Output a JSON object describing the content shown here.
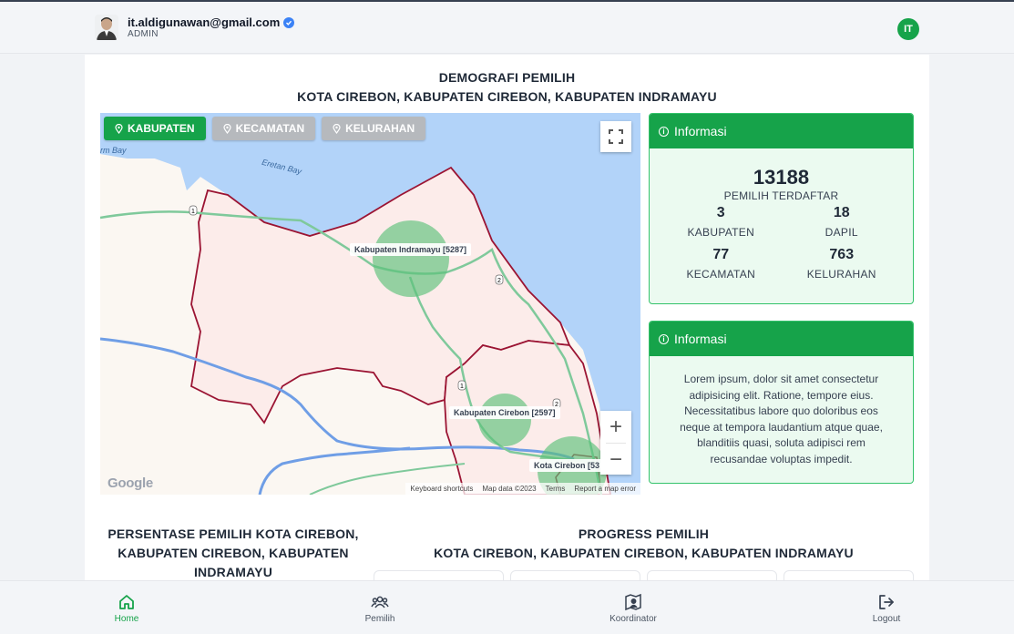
{
  "user": {
    "email": "it.aldigunawan@gmail.com",
    "role": "ADMIN",
    "initials": "IT"
  },
  "page": {
    "title_line1": "DEMOGRAFI PEMILIH",
    "title_line2": "KOTA CIREBON, KABUPATEN CIREBON, KABUPATEN INDRAMAYU"
  },
  "map": {
    "tabs": [
      {
        "label": "KABUPATEN",
        "active": true
      },
      {
        "label": "KECAMATAN",
        "active": false
      },
      {
        "label": "KELURAHAN",
        "active": false
      }
    ],
    "labels": [
      "Kabupaten Indramayu [5287]",
      "Kabupaten Cirebon [2597]",
      "Kota Cirebon [53"
    ],
    "water_labels": [
      "Eretan Bay",
      "rm Bay"
    ],
    "road_markers": [
      "1",
      "2",
      "1",
      "2"
    ],
    "logo": "Google",
    "footer": [
      "Keyboard shortcuts",
      "Map data ©2023",
      "Terms",
      "Report a map error"
    ],
    "zoom_in": "+",
    "zoom_out": "−"
  },
  "info_stats": {
    "header": "Informasi",
    "total": "13188",
    "total_label": "PEMILIH TERDAFTAR",
    "stats": [
      {
        "value": "3",
        "label": "KABUPATEN"
      },
      {
        "value": "18",
        "label": "DAPIL"
      },
      {
        "value": "77",
        "label": "KECAMATAN"
      },
      {
        "value": "763",
        "label": "KELURAHAN"
      }
    ]
  },
  "info_text": {
    "header": "Informasi",
    "body": "Lorem ipsum, dolor sit amet consectetur adipisicing elit. Ratione, tempore eius. Necessitatibus labore quo doloribus eos neque at tempora laudantium atque quae, blanditiis quasi, soluta adipisci rem recusandae voluptas impedit."
  },
  "persentase": {
    "line1": "PERSENTASE PEMILIH KOTA CIREBON,",
    "line2": "KABUPATEN CIREBON, KABUPATEN",
    "line3": "INDRAMAYU"
  },
  "progress": {
    "line1": "PROGRESS PEMILIH",
    "line2": "KOTA CIREBON, KABUPATEN CIREBON, KABUPATEN INDRAMAYU"
  },
  "nav": [
    {
      "label": "Home",
      "icon": "home-icon",
      "active": true
    },
    {
      "label": "Pemilih",
      "icon": "users-icon",
      "active": false
    },
    {
      "label": "Koordinator",
      "icon": "map-person-icon",
      "active": false
    },
    {
      "label": "Logout",
      "icon": "logout-icon",
      "active": false
    }
  ]
}
